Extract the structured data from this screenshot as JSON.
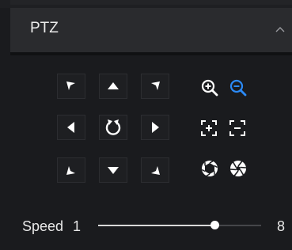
{
  "panel": {
    "title": "PTZ",
    "collapse_icon": "chevron-up-icon"
  },
  "direction_pad": {
    "buttons": [
      {
        "name": "pan-up-left-button",
        "icon": "arrow-up-left-icon"
      },
      {
        "name": "pan-up-button",
        "icon": "arrow-up-icon"
      },
      {
        "name": "pan-up-right-button",
        "icon": "arrow-up-right-icon"
      },
      {
        "name": "pan-left-button",
        "icon": "arrow-left-icon"
      },
      {
        "name": "auto-rotate-button",
        "icon": "rotate-icon"
      },
      {
        "name": "pan-right-button",
        "icon": "arrow-right-icon"
      },
      {
        "name": "pan-down-left-button",
        "icon": "arrow-down-left-icon"
      },
      {
        "name": "pan-down-button",
        "icon": "arrow-down-icon"
      },
      {
        "name": "pan-down-right-button",
        "icon": "arrow-down-right-icon"
      }
    ]
  },
  "lens_controls": {
    "zoom_in_icon": "zoom-in-icon",
    "zoom_out_icon": "zoom-out-icon",
    "focus_near_icon": "focus-near-icon",
    "focus_far_icon": "focus-far-icon",
    "iris_close_icon": "iris-close-icon",
    "iris_open_icon": "iris-open-icon",
    "active_color": "#2b8af7"
  },
  "speed": {
    "label": "Speed",
    "min": "1",
    "max": "8",
    "value": 6
  }
}
